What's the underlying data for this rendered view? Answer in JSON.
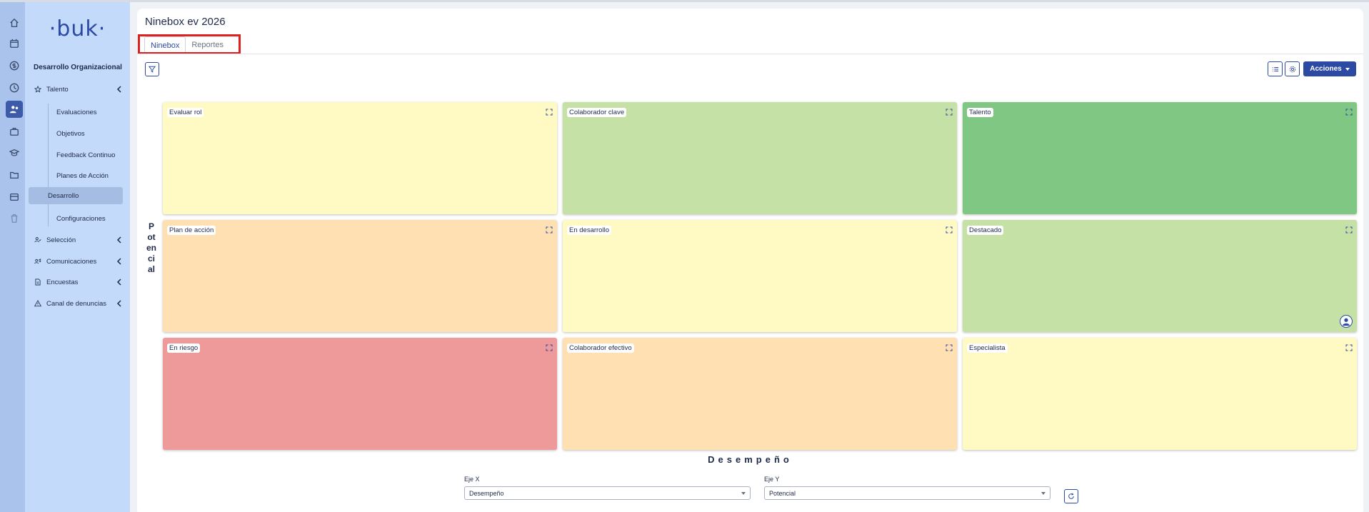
{
  "app": {
    "logo": "·buk·"
  },
  "rail": {
    "icons": [
      "home-icon",
      "calendar-icon",
      "dollar-icon",
      "clock-icon",
      "people-icon",
      "briefcase-icon",
      "graduation-icon",
      "folder-icon",
      "card-icon",
      "trash-icon"
    ],
    "active": "people-icon"
  },
  "sidebar": {
    "section_title": "Desarrollo Organizacional",
    "talento": "Talento",
    "talento_items": [
      "Evaluaciones",
      "Objetivos",
      "Feedback Continuo",
      "Planes de Acción",
      "Desarrollo",
      "Configuraciones"
    ],
    "seleccion": "Selección",
    "comunicaciones": "Comunicaciones",
    "encuestas": "Encuestas",
    "denuncias": "Canal de denuncias"
  },
  "header": {
    "title": "Ninebox ev 2026",
    "tabs": [
      "Ninebox",
      "Reportes"
    ],
    "active_tab": "Ninebox"
  },
  "toolbar": {
    "actions_label": "Acciones"
  },
  "grid": {
    "y_axis": "Potencial",
    "x_axis": "Desempeño",
    "boxes": [
      {
        "label": "Evaluar rol",
        "color": "#fff9c4"
      },
      {
        "label": "Colaborador clave",
        "color": "#c5e1a5"
      },
      {
        "label": "Talento",
        "color": "#81c784"
      },
      {
        "label": "Plan de acción",
        "color": "#ffe0b2"
      },
      {
        "label": "En desarrollo",
        "color": "#fff9c4"
      },
      {
        "label": "Destacado",
        "color": "#c5e1a5"
      },
      {
        "label": "En riesgo",
        "color": "#ef9a9a"
      },
      {
        "label": "Colaborador efectivo",
        "color": "#ffe0b2"
      },
      {
        "label": "Especialista",
        "color": "#fff9c4"
      }
    ]
  },
  "axes_controls": {
    "x_label": "Eje X",
    "x_value": "Desempeño",
    "y_label": "Eje Y",
    "y_value": "Potencial"
  }
}
